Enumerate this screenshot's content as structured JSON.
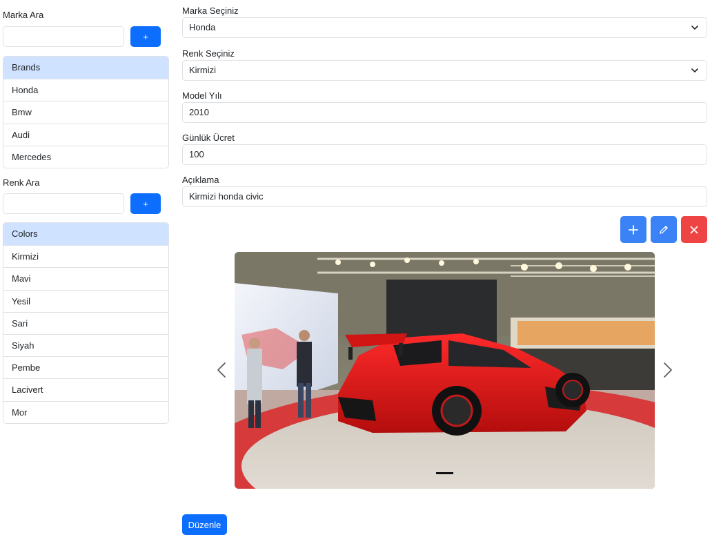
{
  "brand_search": {
    "label": "Marka Ara",
    "add_label": "+"
  },
  "brands": {
    "header": "Brands",
    "items": [
      "Honda",
      "Bmw",
      "Audi",
      "Mercedes"
    ]
  },
  "color_search": {
    "label": "Renk Ara",
    "add_label": "+"
  },
  "colors": {
    "header": "Colors",
    "items": [
      "Kirmizi",
      "Mavi",
      "Yesil",
      "Sari",
      "Siyah",
      "Pembe",
      "Lacivert",
      "Mor"
    ]
  },
  "form": {
    "brand_label": "Marka Seçiniz",
    "brand_value": "Honda",
    "color_label": "Renk Seçiniz",
    "color_value": "Kirmizi",
    "year_label": "Model Yılı",
    "year_value": "2010",
    "price_label": "Günlük Ücret",
    "price_value": "100",
    "desc_label": "Açıklama",
    "desc_value": "Kirmizi honda civic"
  },
  "actions": {
    "add_icon": "plus-icon",
    "edit_icon": "pencil-icon",
    "delete_icon": "close-icon"
  },
  "carousel": {
    "prev_icon": "chevron-left-icon",
    "next_icon": "chevron-right-icon",
    "active_slide": 1,
    "slide_count": 1
  },
  "submit_label": "Düzenle",
  "colors_theme": {
    "primary": "#0d6efd",
    "action_blue": "#3b82f6",
    "danger": "#ef4444",
    "list_active": "#cfe2ff"
  }
}
